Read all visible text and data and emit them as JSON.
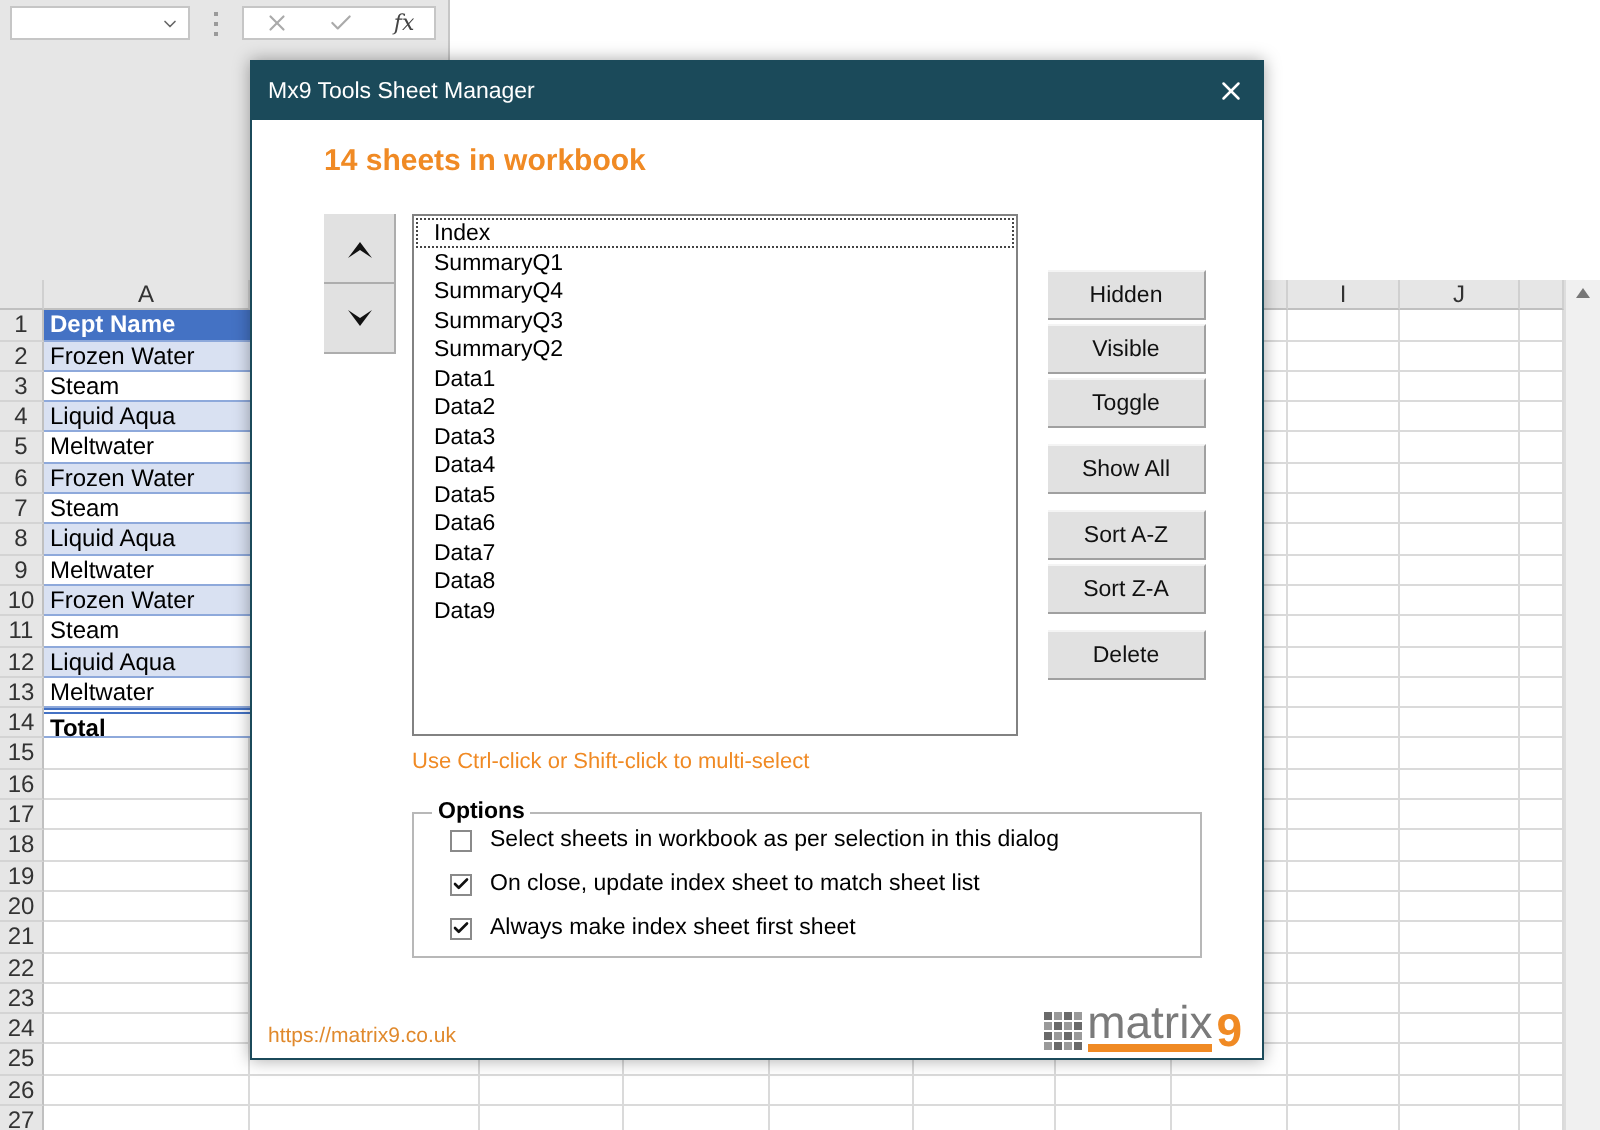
{
  "formula_bar": {
    "function_label": "fx"
  },
  "sheet": {
    "column_headers": [
      {
        "label": "A"
      },
      {
        "label": "I"
      },
      {
        "label": "J"
      }
    ],
    "rows": [
      {
        "number": "1",
        "value": "Dept Name",
        "kind": "header"
      },
      {
        "number": "2",
        "value": "Frozen Water",
        "kind": "band"
      },
      {
        "number": "3",
        "value": "Steam",
        "kind": "plain"
      },
      {
        "number": "4",
        "value": "Liquid Aqua",
        "kind": "band"
      },
      {
        "number": "5",
        "value": "Meltwater",
        "kind": "plain"
      },
      {
        "number": "6",
        "value": "Frozen Water",
        "kind": "band"
      },
      {
        "number": "7",
        "value": "Steam",
        "kind": "plain"
      },
      {
        "number": "8",
        "value": "Liquid Aqua",
        "kind": "band"
      },
      {
        "number": "9",
        "value": "Meltwater",
        "kind": "plain"
      },
      {
        "number": "10",
        "value": "Frozen Water",
        "kind": "band"
      },
      {
        "number": "11",
        "value": "Steam",
        "kind": "plain"
      },
      {
        "number": "12",
        "value": "Liquid Aqua",
        "kind": "band"
      },
      {
        "number": "13",
        "value": "Meltwater",
        "kind": "plain"
      },
      {
        "number": "14",
        "value": "Total",
        "kind": "total"
      },
      {
        "number": "15",
        "kind": "empty"
      },
      {
        "number": "16",
        "kind": "empty"
      },
      {
        "number": "17",
        "kind": "empty"
      },
      {
        "number": "18",
        "kind": "empty"
      },
      {
        "number": "19",
        "kind": "empty"
      },
      {
        "number": "20",
        "kind": "empty"
      },
      {
        "number": "21",
        "kind": "empty"
      },
      {
        "number": "22",
        "kind": "empty"
      },
      {
        "number": "23",
        "kind": "empty"
      },
      {
        "number": "24",
        "kind": "empty"
      },
      {
        "number": "25",
        "kind": "empty"
      },
      {
        "number": "26",
        "kind": "empty"
      },
      {
        "number": "27",
        "kind": "empty"
      }
    ]
  },
  "dialog": {
    "title": "Mx9 Tools Sheet Manager",
    "heading": "14 sheets in workbook",
    "sheets": [
      {
        "name": "Index",
        "focused": true
      },
      {
        "name": "SummaryQ1",
        "focused": false
      },
      {
        "name": "SummaryQ4",
        "focused": false
      },
      {
        "name": "SummaryQ3",
        "focused": false
      },
      {
        "name": "SummaryQ2",
        "focused": false
      },
      {
        "name": "Data1",
        "focused": false
      },
      {
        "name": "Data2",
        "focused": false
      },
      {
        "name": "Data3",
        "focused": false
      },
      {
        "name": "Data4",
        "focused": false
      },
      {
        "name": "Data5",
        "focused": false
      },
      {
        "name": "Data6",
        "focused": false
      },
      {
        "name": "Data7",
        "focused": false
      },
      {
        "name": "Data8",
        "focused": false
      },
      {
        "name": "Data9",
        "focused": false
      }
    ],
    "buttons": [
      "Hidden",
      "Visible",
      "Toggle",
      "Show All",
      "Sort A-Z",
      "Sort Z-A",
      "Delete"
    ],
    "hint": "Use Ctrl-click or Shift-click to multi-select",
    "options": {
      "title": "Options",
      "items": [
        {
          "label": "Select sheets in workbook as per selection in this dialog",
          "checked": false
        },
        {
          "label": "On close, update index sheet to match sheet list",
          "checked": true
        },
        {
          "label": "Always make index sheet first sheet",
          "checked": true
        }
      ]
    },
    "link": "https://matrix9.co.uk",
    "logo": {
      "word": "matrix",
      "digit": "9"
    }
  }
}
